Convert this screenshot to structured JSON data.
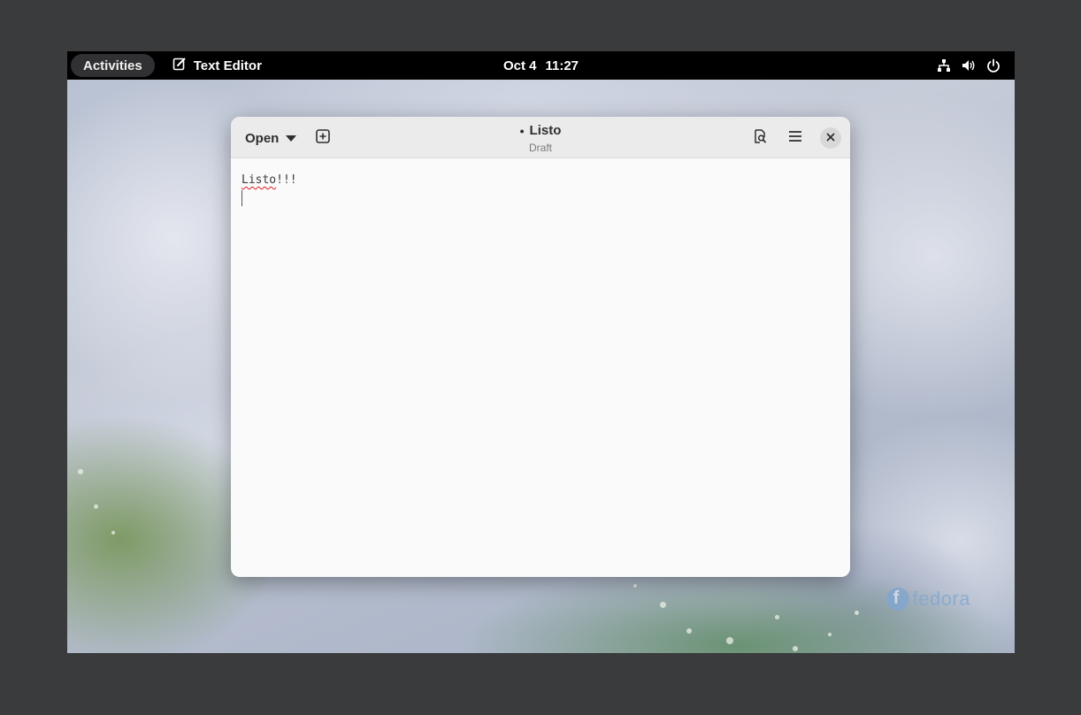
{
  "topbar": {
    "activities_label": "Activities",
    "app_name": "Text Editor",
    "date": "Oct 4",
    "time": "11:27",
    "tray_icons": [
      "network-wired-icon",
      "volume-icon",
      "power-icon"
    ]
  },
  "window": {
    "open_label": "Open",
    "title": "Listo",
    "modified_indicator": "•",
    "subtitle": "Draft",
    "buttons": [
      "new-tab-icon",
      "find-icon",
      "menu-icon",
      "close-icon"
    ]
  },
  "editor": {
    "lines": [
      {
        "misspelled": "Listo",
        "rest": "!!!"
      },
      {
        "text": ""
      }
    ]
  },
  "wallpaper": {
    "logo_text": "fedora",
    "accent": "#7fa6d0"
  }
}
